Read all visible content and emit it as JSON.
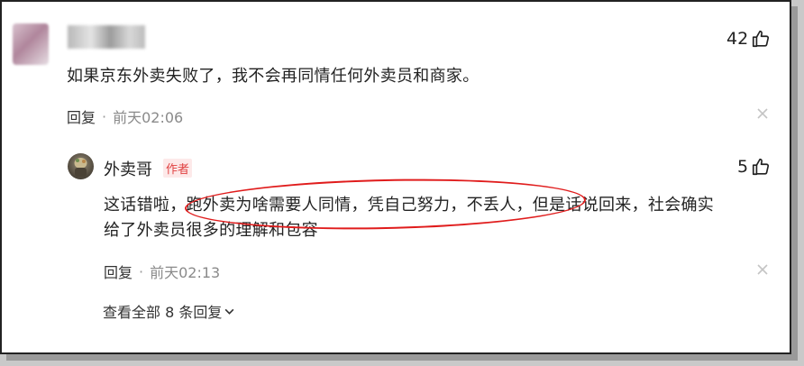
{
  "comment": {
    "likes": "42",
    "text": "如果京东外卖失败了，我不会再同情任何外卖员和商家。",
    "reply_label": "回复",
    "separator": "·",
    "time": "前天02:06"
  },
  "reply": {
    "username": "外卖哥",
    "author_tag": "作者",
    "likes": "5",
    "text_line1": "这话错啦，跑外卖为啥需要人同情，凭自己努力，不丢人，但是话说回来，社会确实",
    "text_line2": "给了外卖员很多的理解和包容",
    "reply_label": "回复",
    "separator": "·",
    "time": "前天02:13"
  },
  "view_more": {
    "label": "查看全部 8 条回复"
  },
  "icons": {
    "like": "thumbs-up-icon",
    "close": "close-icon",
    "chevron": "chevron-down-icon"
  },
  "colors": {
    "highlight_ellipse": "#e01c1c",
    "author_tag": "#e04242"
  }
}
